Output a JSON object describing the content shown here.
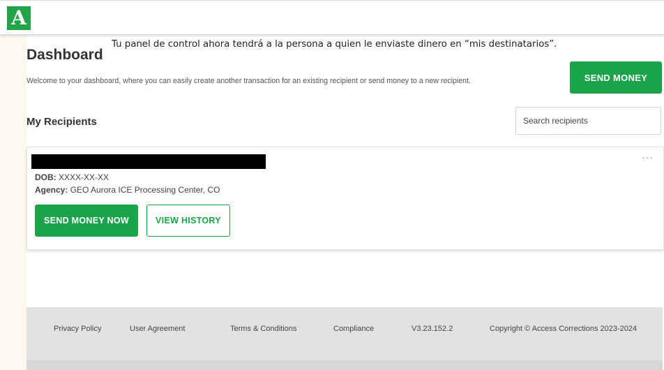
{
  "brand": {
    "logo_letter": "A",
    "accent": "#1aa34a"
  },
  "caption": "Tu panel de control ahora tendrá a la persona a quien le enviaste dinero en “mis destinatarios”.",
  "header": {
    "title": "Dashboard",
    "welcome": "Welcome to your dashboard, where you can easily create another transaction for an existing recipient or send money to a new recipient.",
    "send_money_label": "SEND MONEY"
  },
  "recipients": {
    "title": "My Recipients",
    "search_placeholder": "Search recipients",
    "items": [
      {
        "more_label": "···",
        "dob_label": "DOB:",
        "dob_value": "XXXX-XX-XX",
        "agency_label": "Agency:",
        "agency_value": "GEO Aurora ICE Processing Center, CO",
        "send_now_label": "SEND MONEY NOW",
        "history_label": "VIEW HISTORY"
      }
    ]
  },
  "footer": {
    "privacy": "Privacy Policy",
    "agreement": "User Agreement",
    "terms": "Terms & Conditions",
    "compliance": "Compliance",
    "version": "V3.23.152.2",
    "copyright": "Copyright © Access Corrections 2023-2024"
  }
}
